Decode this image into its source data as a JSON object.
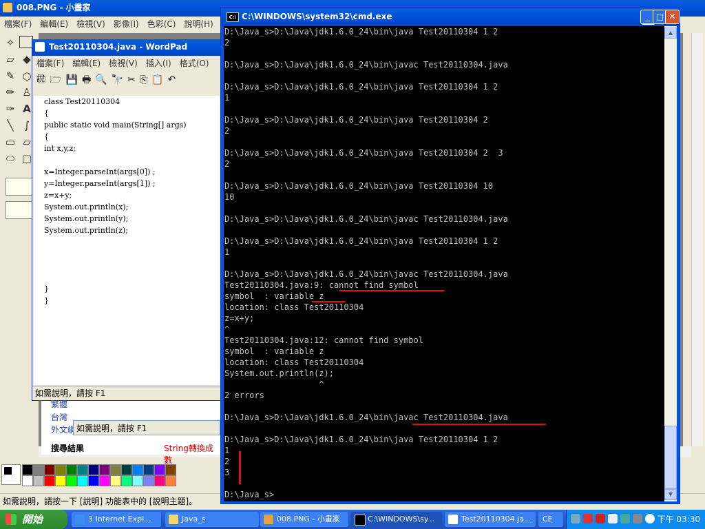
{
  "paint": {
    "title": "008.PNG - 小畫家",
    "menu": [
      "檔案(F)",
      "編輯(E)",
      "檢視(V)",
      "影像(I)",
      "色彩(C)",
      "說明(H)"
    ],
    "status": "如需說明，請按一下 [說明] 功能表中的 [說明主題]。",
    "palette": [
      "#000000",
      "#808080",
      "#800000",
      "#808000",
      "#008000",
      "#008080",
      "#000080",
      "#800080",
      "#808040",
      "#004040",
      "#0080ff",
      "#004080",
      "#8000ff",
      "#804000",
      "#ffffff",
      "#c0c0c0",
      "#ff0000",
      "#ffff00",
      "#00ff00",
      "#00ffff",
      "#0000ff",
      "#ff00ff",
      "#ffff80",
      "#00ff80",
      "#80ffff",
      "#8080ff",
      "#ff0080",
      "#ff8040"
    ]
  },
  "ie_peek": {
    "lines": [
      "繁體",
      "台灣",
      "外文網",
      "搜尋結果"
    ],
    "snippet": "String轉換成數"
  },
  "wordpad": {
    "title": "Test20110304.java - WordPad",
    "menu": [
      "檔案(F)",
      "編輯(E)",
      "檢視(V)",
      "插入(I)",
      "格式(O)",
      "說"
    ],
    "toolbar": [
      "🗋",
      "🗁",
      "💾",
      "🖶",
      "🔍",
      "🔭",
      "✂",
      "⎘",
      "📋",
      "↶"
    ],
    "code": [
      "class Test20110304",
      "{",
      "public static void main(String[] args)",
      "{",
      "int x,y,z;",
      "",
      "x=Integer.parseInt(args[0]) ;",
      "y=Integer.parseInt(args[1]) ;",
      "z=x+y;",
      "System.out.println(x);",
      "System.out.println(y);",
      "System.out.println(z);",
      "",
      "",
      "",
      "",
      "}",
      "}"
    ],
    "status": "如需說明，請按 F1",
    "status2": "如需說明，請按 F1"
  },
  "cmd": {
    "title": "C:\\WINDOWS\\system32\\cmd.exe",
    "lines": [
      "D:\\Java_s>D:\\Java\\jdk1.6.0_24\\bin\\java Test20110304 1 2",
      "2",
      "",
      "D:\\Java_s>D:\\Java\\jdk1.6.0_24\\bin\\javac Test20110304.java",
      "",
      "D:\\Java_s>D:\\Java\\jdk1.6.0_24\\bin\\java Test20110304 1 2",
      "1",
      "",
      "D:\\Java_s>D:\\Java\\jdk1.6.0_24\\bin\\java Test20110304 2",
      "2",
      "",
      "D:\\Java_s>D:\\Java\\jdk1.6.0_24\\bin\\java Test20110304 2  3",
      "2",
      "",
      "D:\\Java_s>D:\\Java\\jdk1.6.0_24\\bin\\java Test20110304 10",
      "10",
      "",
      "D:\\Java_s>D:\\Java\\jdk1.6.0_24\\bin\\javac Test20110304.java",
      "",
      "D:\\Java_s>D:\\Java\\jdk1.6.0_24\\bin\\java Test20110304 1 2",
      "1",
      "",
      "D:\\Java_s>D:\\Java\\jdk1.6.0_24\\bin\\javac Test20110304.java",
      "Test20110304.java:9: cannot find symbol",
      "symbol  : variable z",
      "location: class Test20110304",
      "z=x+y;",
      "^",
      "Test20110304.java:12: cannot find symbol",
      "symbol  : variable z",
      "location: class Test20110304",
      "System.out.println(z);",
      "                   ^",
      "2 errors",
      "",
      "D:\\Java_s>D:\\Java\\jdk1.6.0_24\\bin\\javac Test20110304.java",
      "",
      "D:\\Java_s>D:\\Java\\jdk1.6.0_24\\bin\\java Test20110304 1 2",
      "1",
      "2",
      "3",
      "",
      "D:\\Java_s>"
    ]
  },
  "taskbar": {
    "start": "開始",
    "tasks": [
      "3 Internet Expl...",
      "Java_s",
      "008.PNG - 小畫家",
      "C:\\WINDOWS\\sy...",
      "Test20110304.ja...",
      "CE"
    ],
    "clock": "下午 03:30"
  }
}
